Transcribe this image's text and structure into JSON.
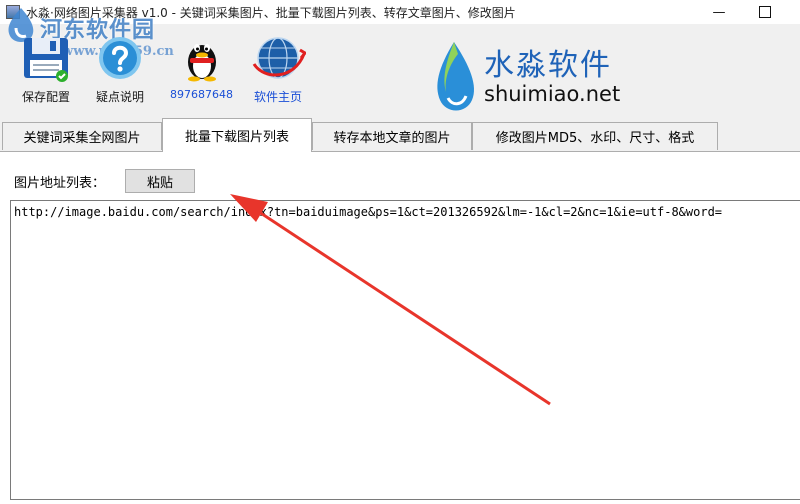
{
  "window": {
    "title": "水淼·网络图片采集器 v1.0 - 关键词采集图片、批量下载图片列表、转存文章图片、修改图片",
    "minimize_glyph": "—",
    "maximize_glyph": ""
  },
  "watermark": {
    "title": "河东软件园",
    "url": "www.pc0359.cn"
  },
  "toolbar": {
    "items": [
      {
        "label": "保存配置",
        "icon": "floppy-disk-icon"
      },
      {
        "label": "疑点说明",
        "icon": "help-question-icon"
      },
      {
        "label": "897687648",
        "icon": "qq-penguin-icon"
      },
      {
        "label": "软件主页",
        "icon": "globe-icon"
      }
    ]
  },
  "brand": {
    "name": "水淼软件",
    "url": "shuimiao.net",
    "icon": "water-drop-logo"
  },
  "tabs": [
    {
      "label": "关键词采集全网图片",
      "active": false
    },
    {
      "label": "批量下载图片列表",
      "active": true
    },
    {
      "label": "转存本地文章的图片",
      "active": false
    },
    {
      "label": "修改图片MD5、水印、尺寸、格式",
      "active": false
    }
  ],
  "panel": {
    "url_list_label": "图片地址列表：",
    "paste_button": "粘贴",
    "url_text": "http://image.baidu.com/search/index?tn=baiduimage&ps=1&ct=201326592&lm=-1&cl=2&nc=1&ie=utf-8&word="
  },
  "colors": {
    "accent_blue": "#1f63b8",
    "annotation_red": "#e8352b",
    "window_bg": "#f0f0f0"
  }
}
